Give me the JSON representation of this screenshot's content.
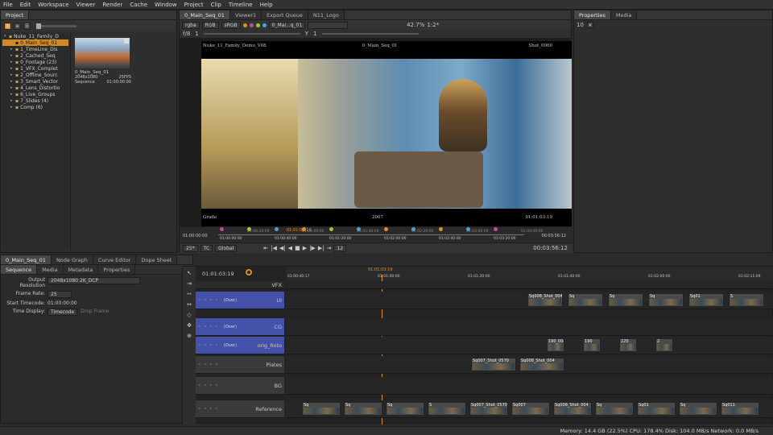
{
  "menu": [
    "File",
    "Edit",
    "Workspace",
    "Viewer",
    "Render",
    "Cache",
    "Window",
    "Project",
    "Clip",
    "Timeline",
    "Help"
  ],
  "project_panel": {
    "tab": "Project",
    "tree": [
      {
        "label": "Nuke_11_Family_D",
        "level": 0,
        "sel": false
      },
      {
        "label": "0_Main_Seq_01",
        "level": 1,
        "sel": true
      },
      {
        "label": "1_TimeLine_Dis",
        "level": 1,
        "sel": false
      },
      {
        "label": "2_Cached_Seq",
        "level": 1,
        "sel": false
      },
      {
        "label": "0_Footage (23)",
        "level": 1,
        "sel": false
      },
      {
        "label": "1_VFX_Complet",
        "level": 1,
        "sel": false
      },
      {
        "label": "2_Offline_Sourc",
        "level": 1,
        "sel": false
      },
      {
        "label": "3_Smart_Vector",
        "level": 1,
        "sel": false
      },
      {
        "label": "4_Lens_Distortio",
        "level": 1,
        "sel": false
      },
      {
        "label": "6_Live_Groups",
        "level": 1,
        "sel": false
      },
      {
        "label": "7_Slides (4)",
        "level": 1,
        "sel": false
      },
      {
        "label": "Comp (6)",
        "level": 1,
        "sel": false
      }
    ],
    "clip": {
      "name": "0_Main_Seq_01",
      "res": "2048x1080",
      "fps": "25FPS",
      "type": "Sequence",
      "tc": "01:00:00:00"
    }
  },
  "viewer_tabs": [
    "0_Main_Seq_01",
    "Viewer1",
    "Export Queue",
    "N11_Logo"
  ],
  "viewer": {
    "channels": "rgba",
    "colorspace": "RGB",
    "display": "sRGB",
    "input": "0_Mai...q_01",
    "zoom": "42.7%",
    "ratio": "1:2*",
    "fstop": "f/8",
    "gain": "1",
    "y": "Y",
    "yval": "1",
    "overlay_tl": "Nuke_11_Family_Demo_V08",
    "overlay_tc": "0_Main_Seq_01",
    "overlay_tr": "Shot_0060",
    "overlay_bl": "Grade",
    "overlay_bc": "2007",
    "overlay_br": "01:01:03:19",
    "tl_start": "01:00:00:00",
    "tl_end": "00:03:56:12",
    "tl_current": "01:01:03:19",
    "tl_ticks": [
      "01:00:00:00",
      "01:00:40:00",
      "01:01:20:00",
      "01:02:00:00",
      "01:02:40:00",
      "01:03:20:00"
    ],
    "tl_ticks_b": [
      "01:00:20:00",
      "01:01:00:00",
      "01:01:40:00",
      "01:02:20:00",
      "01:03:00:00",
      "01:03:40:00"
    ],
    "fps": "25*",
    "tc": "TC",
    "global": "Global",
    "frame": "12",
    "duration": "00:03:56:12"
  },
  "properties_tabs": [
    "Properties",
    "Media"
  ],
  "properties": {
    "count": "10"
  },
  "bottom_tabs": [
    "0_Main_Seq_01",
    "Node Graph",
    "Curve Editor",
    "Dope Sheet"
  ],
  "sequence_tabs": [
    "Sequence",
    "Media",
    "Metadata",
    "Properties"
  ],
  "sequence": {
    "output_label": "Output Resolution",
    "output": "2048x1080 2K_DCP",
    "fr_label": "Frame Rate:",
    "fr": "25",
    "stc_label": "Start Timecode:",
    "stc": "01:00:00:00",
    "td_label": "Time Display:",
    "td": "Timecode",
    "drop": "Drop Frame"
  },
  "timeline": {
    "current": "01:01:03:19",
    "ruler_current": "01:01:03:19",
    "r_ticks": [
      "01:00:40:17",
      "01:01:00:00",
      "01:01:20:00",
      "01:01:40:00",
      "01:02:00:00",
      "01:02:11:09"
    ],
    "tracks": [
      {
        "name": "VFX",
        "label": "",
        "color": "#2b2b2b"
      },
      {
        "name": "UI",
        "label": "(Over)",
        "color": "#4351a8"
      },
      {
        "name": "CG",
        "label": "(Over)",
        "color": "#4351a8"
      },
      {
        "name": "orig_Roto",
        "label": "(Over)",
        "color": "#4351a8"
      },
      {
        "name": "Plates",
        "label": "",
        "color": "#3a3a3a"
      },
      {
        "name": "BG",
        "label": "",
        "color": "#3a3a3a"
      },
      {
        "name": "Reference",
        "label": "",
        "color": "#3a3a3a"
      }
    ],
    "clips_ui": [
      "Sq008_Shot_004",
      "Sq",
      "Sq",
      "Sq",
      "Sq01",
      "S"
    ],
    "clips_roto": [
      "190_004",
      "190",
      "220",
      "2"
    ],
    "clips_plates": [
      "Sq007_Shot_0570",
      "Sq008_Shot_004"
    ],
    "clips_ref": [
      "Sq",
      "Sq",
      "Sq",
      "S",
      "Sq007_Shot_0570",
      "Sq007",
      "Sq008_Shot_004",
      "Sq",
      "Sq01",
      "Sq",
      "Sq011"
    ]
  },
  "status": "Memory: 14.4 GB (22.5%) CPU: 178.4% Disk: 104.0 MB/s Network: 0.0 MB/s",
  "colors": {
    "accent": "#e0901f",
    "track_blue": "#4351a8",
    "clip_blue": "#3b6fb5"
  }
}
